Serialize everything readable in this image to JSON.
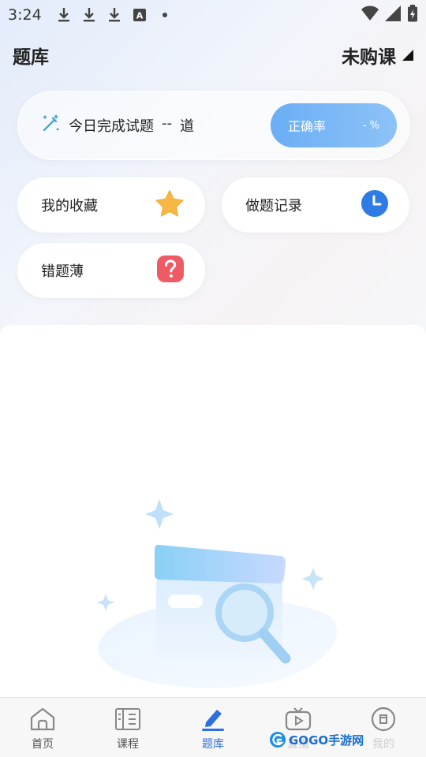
{
  "status_bar": {
    "time": "3:24",
    "icons": [
      "download-icon",
      "download-icon",
      "download-icon",
      "keyboard-a-icon",
      "dot-icon",
      "wifi-icon",
      "signal-icon",
      "battery-icon"
    ]
  },
  "header": {
    "title": "题库",
    "course_selector": "未购课"
  },
  "daily_stats": {
    "label": "今日完成试题",
    "count": "--",
    "unit": "道",
    "accuracy_label": "正确率",
    "accuracy_value": "- %"
  },
  "actions": {
    "favorites": "我的收藏",
    "history": "做题记录",
    "mistakes": "错题薄"
  },
  "bottom_nav": {
    "items": [
      {
        "label": "首页",
        "icon": "home-icon"
      },
      {
        "label": "课程",
        "icon": "course-icon"
      },
      {
        "label": "题库",
        "icon": "pencil-icon"
      },
      {
        "label": "直播",
        "icon": "tv-play-icon"
      },
      {
        "label": "我的",
        "icon": "profile-icon"
      }
    ],
    "active_index": 2
  },
  "watermark": {
    "text": "GOGO手游网"
  },
  "colors": {
    "accent": "#2f6fe0",
    "accuracy_pill": "#6aaef5",
    "star": "#f7b843",
    "mistake": "#ef5b64",
    "clock": "#2f7be6"
  }
}
